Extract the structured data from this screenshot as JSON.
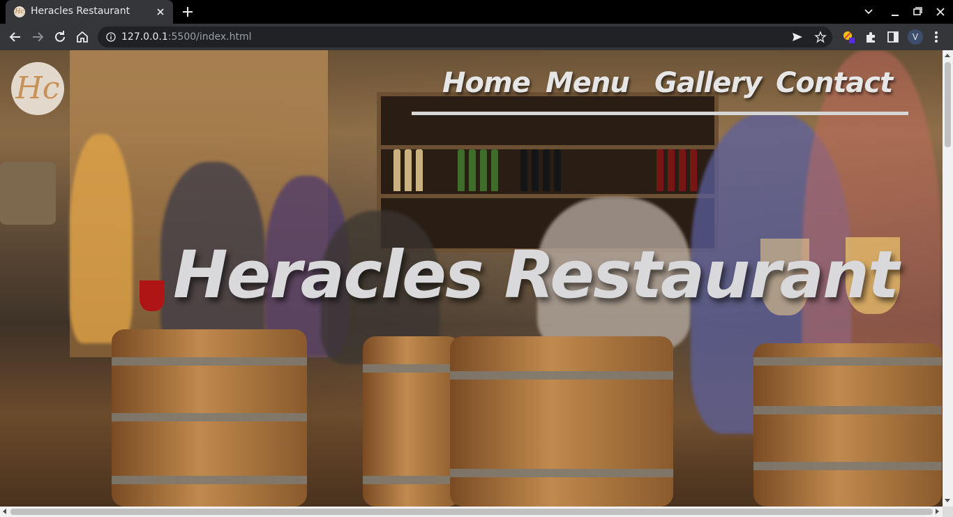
{
  "browser": {
    "tab": {
      "title": "Heracles Restaurant",
      "favicon_text": "Hc",
      "close_icon": "close-icon"
    },
    "new_tab_icon": "plus-icon",
    "window_controls": [
      "chevron-down-icon",
      "minimize-icon",
      "restore-icon",
      "close-icon"
    ],
    "address": {
      "host": "127.0.0.1",
      "path": ":5500/index.html"
    },
    "nav_icons": [
      "back-icon",
      "forward-icon",
      "reload-icon",
      "home-icon"
    ],
    "toolbar_icons": [
      "send-icon",
      "star-icon",
      "extension-color-icon",
      "puzzle-icon",
      "sidepanel-icon"
    ],
    "profile_initial": "V"
  },
  "site": {
    "logo_text": "Hc",
    "nav": [
      {
        "label": "Home"
      },
      {
        "label": "Menu"
      },
      {
        "label": "Gallery"
      },
      {
        "label": "Contact"
      }
    ],
    "hero_title": "Heracles Restaurant"
  },
  "colors": {
    "chrome_dark": "#000000",
    "chrome_toolbar": "#35363a",
    "nav_text": "#e6e6e6",
    "logo_bg": "#e3d8cc",
    "logo_text": "#c89156"
  }
}
